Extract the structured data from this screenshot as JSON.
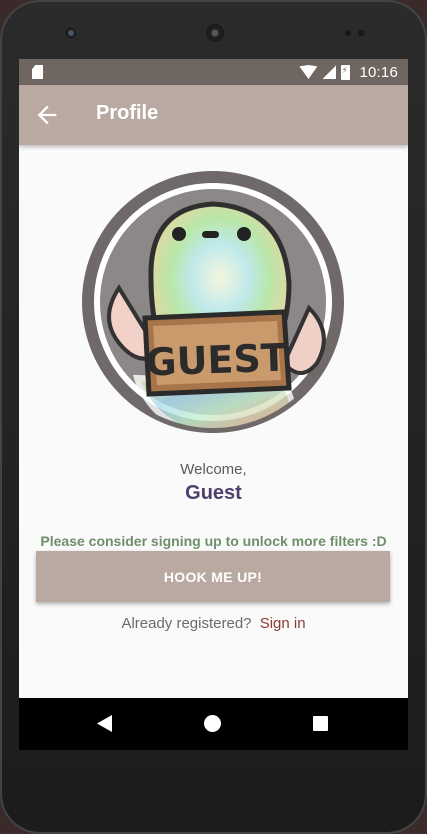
{
  "status_bar": {
    "time": "10:16",
    "icons": [
      "sd-card-icon",
      "wifi-icon",
      "cell-signal-icon",
      "battery-charging-icon"
    ]
  },
  "app_bar": {
    "title": "Profile",
    "back_icon": "arrow-left-icon",
    "color": "#b9a9a1"
  },
  "profile": {
    "welcome_text": "Welcome,",
    "username": "Guest",
    "avatar_sign_text": "GUEST"
  },
  "signup": {
    "notice": "Please consider signing up to unlock more filters :D",
    "button_label": "HOOK ME UP!",
    "already_registered": "Already registered?",
    "sign_in_link": "Sign in"
  },
  "colors": {
    "accent": "#b9a9a1",
    "username": "#4e3f6b",
    "notice": "#6f8f6a",
    "link": "#8a3c36"
  },
  "nav_bar": {
    "icons": [
      "nav-back-icon",
      "nav-home-icon",
      "nav-recents-icon"
    ]
  }
}
